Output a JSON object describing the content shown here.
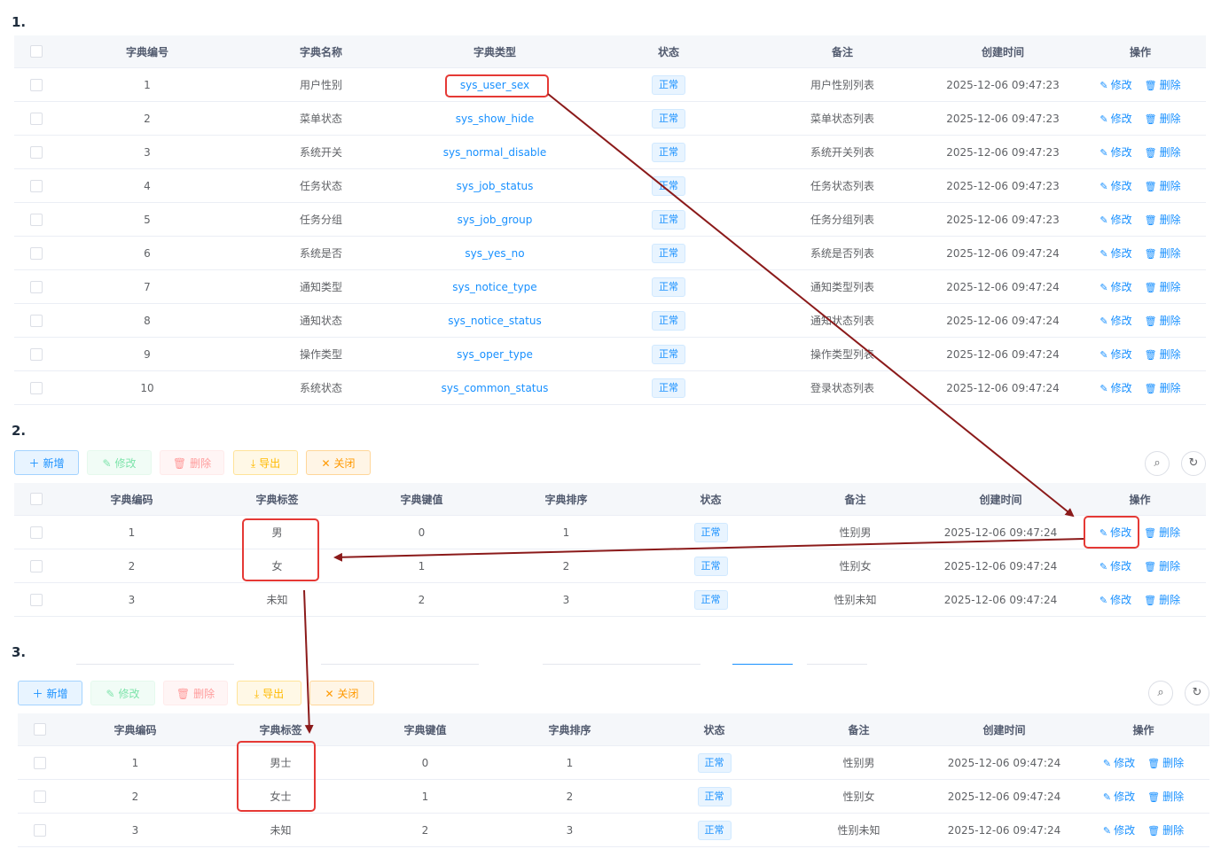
{
  "steps": [
    "1.",
    "2.",
    "3."
  ],
  "type_table": {
    "headers": [
      "字典编号",
      "字典名称",
      "字典类型",
      "状态",
      "备注",
      "创建时间",
      "操作"
    ],
    "rows": [
      {
        "id": "1",
        "name": "用户性别",
        "type": "sys_user_sex",
        "status": "正常",
        "remark": "用户性别列表",
        "time": "2025-12-06 09:47:23"
      },
      {
        "id": "2",
        "name": "菜单状态",
        "type": "sys_show_hide",
        "status": "正常",
        "remark": "菜单状态列表",
        "time": "2025-12-06 09:47:23"
      },
      {
        "id": "3",
        "name": "系统开关",
        "type": "sys_normal_disable",
        "status": "正常",
        "remark": "系统开关列表",
        "time": "2025-12-06 09:47:23"
      },
      {
        "id": "4",
        "name": "任务状态",
        "type": "sys_job_status",
        "status": "正常",
        "remark": "任务状态列表",
        "time": "2025-12-06 09:47:23"
      },
      {
        "id": "5",
        "name": "任务分组",
        "type": "sys_job_group",
        "status": "正常",
        "remark": "任务分组列表",
        "time": "2025-12-06 09:47:23"
      },
      {
        "id": "6",
        "name": "系统是否",
        "type": "sys_yes_no",
        "status": "正常",
        "remark": "系统是否列表",
        "time": "2025-12-06 09:47:24"
      },
      {
        "id": "7",
        "name": "通知类型",
        "type": "sys_notice_type",
        "status": "正常",
        "remark": "通知类型列表",
        "time": "2025-12-06 09:47:24"
      },
      {
        "id": "8",
        "name": "通知状态",
        "type": "sys_notice_status",
        "status": "正常",
        "remark": "通知状态列表",
        "time": "2025-12-06 09:47:24"
      },
      {
        "id": "9",
        "name": "操作类型",
        "type": "sys_oper_type",
        "status": "正常",
        "remark": "操作类型列表",
        "time": "2025-12-06 09:47:24"
      },
      {
        "id": "10",
        "name": "系统状态",
        "type": "sys_common_status",
        "status": "正常",
        "remark": "登录状态列表",
        "time": "2025-12-06 09:47:24"
      }
    ]
  },
  "actions": {
    "edit": "修改",
    "delete": "删除"
  },
  "toolbar": {
    "add": "新增",
    "edit": "修改",
    "delete": "删除",
    "export": "导出",
    "close": "关闭"
  },
  "data_headers": [
    "字典编码",
    "字典标签",
    "字典键值",
    "字典排序",
    "状态",
    "备注",
    "创建时间",
    "操作"
  ],
  "data_before": [
    {
      "code": "1",
      "label": "男",
      "value": "0",
      "sort": "1",
      "status": "正常",
      "remark": "性别男",
      "time": "2025-12-06 09:47:24"
    },
    {
      "code": "2",
      "label": "女",
      "value": "1",
      "sort": "2",
      "status": "正常",
      "remark": "性别女",
      "time": "2025-12-06 09:47:24"
    },
    {
      "code": "3",
      "label": "未知",
      "value": "2",
      "sort": "3",
      "status": "正常",
      "remark": "性别未知",
      "time": "2025-12-06 09:47:24"
    }
  ],
  "data_after": [
    {
      "code": "1",
      "label": "男士",
      "value": "0",
      "sort": "1",
      "status": "正常",
      "remark": "性别男",
      "time": "2025-12-06 09:47:24"
    },
    {
      "code": "2",
      "label": "女士",
      "value": "1",
      "sort": "2",
      "status": "正常",
      "remark": "性别女",
      "time": "2025-12-06 09:47:24"
    },
    {
      "code": "3",
      "label": "未知",
      "value": "2",
      "sort": "3",
      "status": "正常",
      "remark": "性别未知",
      "time": "2025-12-06 09:47:24"
    }
  ],
  "icons": {
    "search": "search-icon",
    "refresh": "refresh-icon",
    "edit": "edit-icon",
    "delete": "delete-icon",
    "add": "plus-icon",
    "export": "download-icon",
    "close": "close-icon"
  },
  "colors": {
    "primary": "#1890ff",
    "annotation": "#8b1a1a",
    "highlight": "#e53935"
  }
}
